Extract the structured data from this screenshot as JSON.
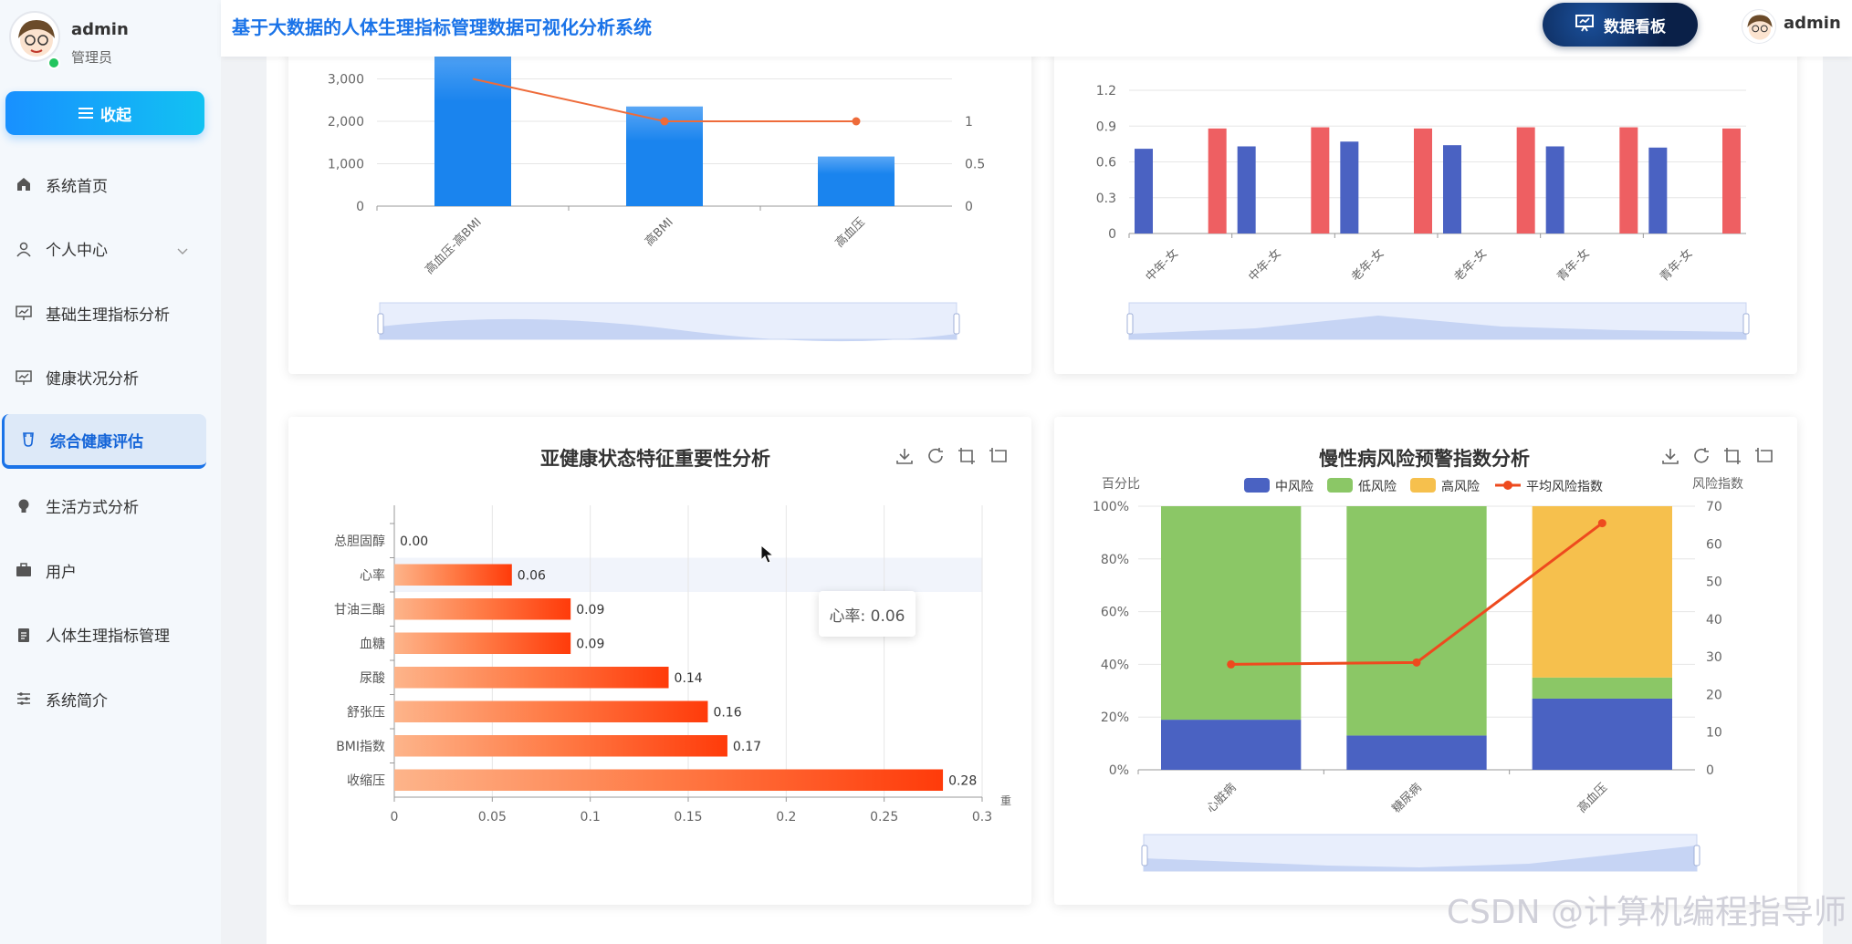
{
  "app": {
    "title": "基于大数据的人体生理指标管理数据可视化分析系统"
  },
  "sidebar": {
    "user_name": "admin",
    "user_role": "管理员",
    "collapse_label": "收起",
    "items": [
      {
        "label": "系统首页",
        "icon": "home-icon"
      },
      {
        "label": "个人中心",
        "icon": "user-icon",
        "has_children": true
      },
      {
        "label": "基础生理指标分析",
        "icon": "chart-board-icon"
      },
      {
        "label": "健康状况分析",
        "icon": "chart-board-icon"
      },
      {
        "label": "综合健康评估",
        "icon": "cup-icon",
        "active": true
      },
      {
        "label": "生活方式分析",
        "icon": "bulb-icon"
      },
      {
        "label": "用户",
        "icon": "briefcase-icon"
      },
      {
        "label": "人体生理指标管理",
        "icon": "clipboard-icon"
      },
      {
        "label": "系统简介",
        "icon": "sliders-icon"
      }
    ]
  },
  "header": {
    "dashboard_label": "数据看板",
    "user_name": "admin"
  },
  "tooltip": {
    "text": "心率: 0.06"
  },
  "watermark": "CSDN @计算机编程指导师",
  "colors": {
    "accent": "#1a73e8",
    "blue_bar": "#1a84ee",
    "red_bar": "#ee5f62",
    "navy_bar": "#4a62c2"
  },
  "chart_data": [
    {
      "id": "top-left",
      "type": "bar",
      "categories": [
        "高血压-高BMI",
        "高BMI",
        "高血压"
      ],
      "values": [
        3800,
        2350,
        1170
      ],
      "line_values": [
        1.5,
        1,
        1
      ],
      "y_ticks": [
        "0",
        "1,000",
        "2,000",
        "3,000"
      ],
      "y2_ticks": [
        "0",
        "0.5",
        "1"
      ],
      "ylim": [
        0,
        4000
      ],
      "y2lim": [
        0,
        2
      ]
    },
    {
      "id": "top-right",
      "type": "bar",
      "categories": [
        "中年-女",
        "中年-女",
        "老年-女",
        "老年-女",
        "青年-女",
        "青年-女"
      ],
      "series": [
        {
          "values": [
            0.71,
            0.73,
            0.77,
            0.74,
            0.73,
            0.72
          ]
        },
        {
          "values": [
            0.88,
            0.89,
            0.88,
            0.89,
            0.89,
            0.88
          ]
        }
      ],
      "y_ticks": [
        "0",
        "0.3",
        "0.6",
        "0.9",
        "1.2"
      ],
      "ylim": [
        0,
        1.2
      ]
    },
    {
      "id": "feature-importance",
      "type": "bar",
      "orientation": "horizontal",
      "title": "亚健康状态特征重要性分析",
      "categories": [
        "总胆固醇",
        "心率",
        "甘油三酯",
        "血糖",
        "尿酸",
        "舒张压",
        "BMI指数",
        "收缩压"
      ],
      "values": [
        0.0,
        0.06,
        0.09,
        0.09,
        0.14,
        0.16,
        0.17,
        0.28
      ],
      "x_ticks": [
        "0",
        "0.05",
        "0.1",
        "0.15",
        "0.2",
        "0.25",
        "0.3"
      ],
      "xlim": [
        0,
        0.3
      ],
      "xlabel": "重"
    },
    {
      "id": "chronic-risk",
      "type": "bar",
      "stacked": true,
      "title": "慢性病风险预警指数分析",
      "ylabel": "百分比",
      "y2label": "风险指数",
      "categories": [
        "心脏病",
        "糖尿病",
        "高血压"
      ],
      "series": [
        {
          "name": "中风险",
          "color": "#4a62c2",
          "values": [
            19,
            13,
            27
          ]
        },
        {
          "name": "低风险",
          "color": "#8bc766",
          "values": [
            81,
            87,
            8
          ]
        },
        {
          "name": "高风险",
          "color": "#f6c04d",
          "values": [
            0,
            0,
            65
          ]
        }
      ],
      "line": {
        "name": "平均风险指数",
        "color": "#ee4a1e",
        "values": [
          28,
          28.5,
          65.5
        ]
      },
      "y_ticks": [
        "0%",
        "20%",
        "40%",
        "60%",
        "80%",
        "100%"
      ],
      "y2_ticks": [
        "0",
        "10",
        "20",
        "30",
        "40",
        "50",
        "60",
        "70"
      ],
      "ylim": [
        0,
        100
      ],
      "y2lim": [
        0,
        70
      ]
    }
  ]
}
